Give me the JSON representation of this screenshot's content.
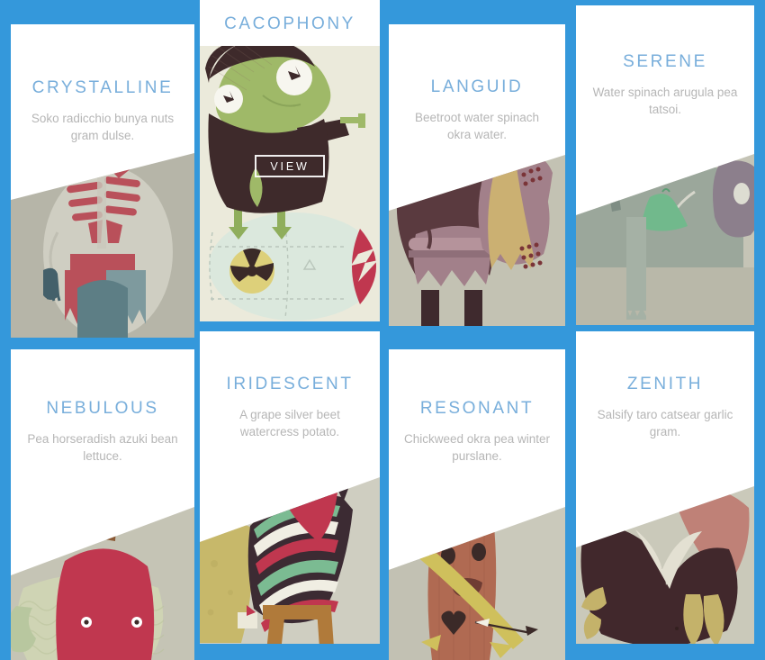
{
  "theme": {
    "background_color": "#3498db",
    "card_background": "#ffffff",
    "title_color": "#78aedb",
    "description_color": "#b6b6b6",
    "view_button_color": "#ffffff"
  },
  "cards": [
    {
      "title": "CRYSTALLINE",
      "description": "Soko radicchio bunya nuts gram dulse.",
      "hovered": false,
      "artwork": "skeleton-illustration"
    },
    {
      "title": "CACOPHONY",
      "description": "",
      "hovered": true,
      "view_label": "VIEW",
      "artwork": "frog-on-bomb-illustration"
    },
    {
      "title": "LANGUID",
      "description": "Beetroot water spinach okra water.",
      "hovered": false,
      "artwork": "cloaked-creature-illustration"
    },
    {
      "title": "SERENE",
      "description": "Water spinach arugula pea tatsoi.",
      "hovered": false,
      "artwork": "grey-elephant-illustration"
    },
    {
      "title": "NEBULOUS",
      "description": "Pea horseradish azuki bean lettuce.",
      "hovered": false,
      "artwork": "apple-fish-illustration"
    },
    {
      "title": "IRIDESCENT",
      "description": "A grape silver beet watercress potato.",
      "hovered": false,
      "artwork": "poncho-figure-illustration"
    },
    {
      "title": "RESONANT",
      "description": "Chickweed okra pea winter purslane.",
      "hovered": false,
      "artwork": "sad-tree-with-arrow-illustration"
    },
    {
      "title": "ZENITH",
      "description": "Salsify taro catsear garlic gram.",
      "hovered": false,
      "artwork": "dark-bird-illustration"
    }
  ]
}
